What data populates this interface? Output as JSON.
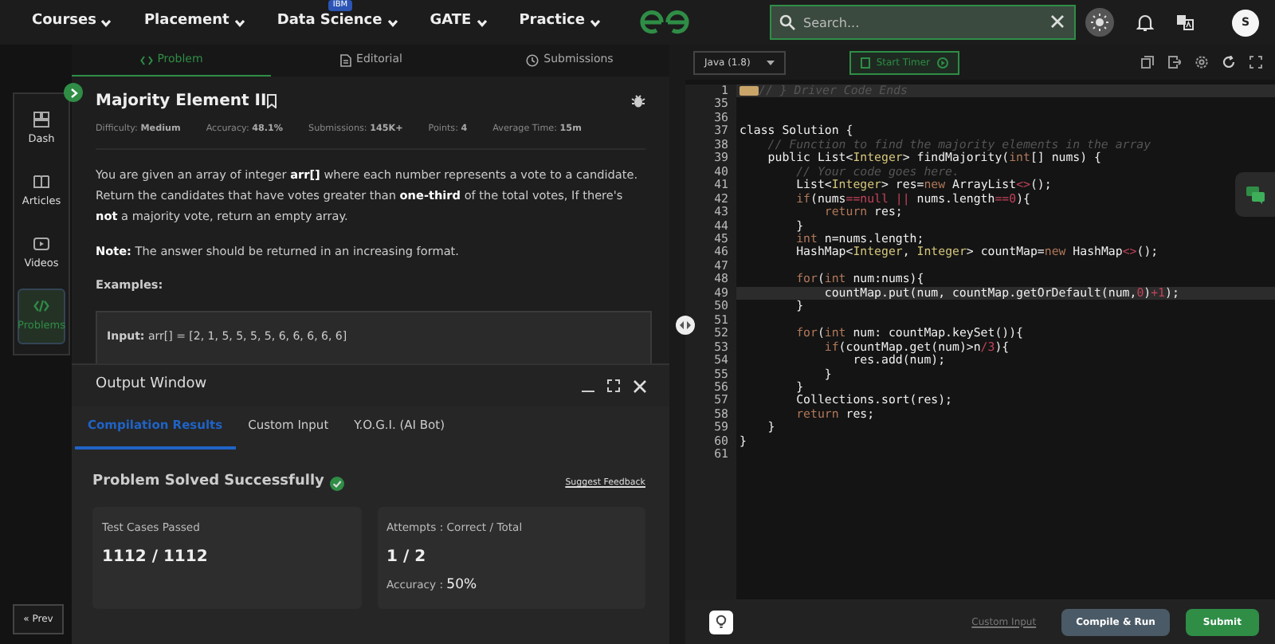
{
  "nav": {
    "items": [
      {
        "label": "Courses"
      },
      {
        "label": "Placement"
      },
      {
        "label": "Data Science",
        "badge": "IBM"
      },
      {
        "label": "GATE"
      },
      {
        "label": "Practice"
      }
    ],
    "search": {
      "placeholder": "Search..."
    },
    "avatar": "S"
  },
  "problem_tabs": [
    {
      "label": "Problem",
      "selected": true
    },
    {
      "label": "Editorial",
      "selected": false
    },
    {
      "label": "Submissions",
      "selected": false
    }
  ],
  "sidebar": {
    "items": [
      {
        "label": "Dash",
        "selected": false
      },
      {
        "label": "Articles",
        "selected": false
      },
      {
        "label": "Videos",
        "selected": false
      },
      {
        "label": "Problems",
        "selected": true
      }
    ],
    "prev_button": "« Prev"
  },
  "problem": {
    "title": "Majority Element II",
    "meta": [
      {
        "label": "Difficulty:",
        "value": "Medium"
      },
      {
        "label": "Accuracy:",
        "value": "48.1%"
      },
      {
        "label": "Submissions:",
        "value": "145K+"
      },
      {
        "label": "Points:",
        "value": "4"
      },
      {
        "label": "Average Time:",
        "value": "15m"
      }
    ],
    "paragraphs": [
      "You are given an array of integer **arr[]** where each number represents a vote to a candidate. Return the candidates that have votes greater than **one-third** of the total votes, If there's **not** a majority vote, return an empty array.",
      "**Note:** The answer should be returned in an increasing format."
    ],
    "examples_heading": "Examples:",
    "example_input": "**Input:** arr[] = [2, 1, 5, 5, 5, 5, 6, 6, 6, 6, 6]"
  },
  "output_window": {
    "title": "Output Window",
    "tabs": [
      {
        "label": "Compilation Results",
        "selected": true
      },
      {
        "label": "Custom Input",
        "selected": false
      },
      {
        "label": "Y.O.G.I. (AI Bot)",
        "selected": false
      }
    ],
    "status": "Problem Solved Successfully",
    "feedback_link": "Suggest Feedback",
    "cards": [
      {
        "label": "Test Cases Passed",
        "value": "1112 / 1112"
      },
      {
        "label": "Attempts : Correct / Total",
        "value": "1 / 2",
        "extra_label": "Accuracy :",
        "extra_value": "50%"
      }
    ]
  },
  "editor": {
    "language": "Java (1.8)",
    "timer_button": "Start Timer",
    "lines": [
      {
        "num": "1",
        "highlighted": true,
        "folded": true,
        "segments": [
          {
            "text": "// } Driver Code Ends",
            "kind": "comment"
          }
        ]
      },
      {
        "num": "35",
        "highlighted": false
      },
      {
        "num": "36",
        "highlighted": false
      },
      {
        "num": "37",
        "highlighted": false,
        "segments": [
          {
            "text": "class Solution {",
            "kind": "plain"
          }
        ]
      },
      {
        "num": "38",
        "highlighted": false,
        "segments": [
          {
            "text": "    // Function to find the majority elements in the array",
            "kind": "comment"
          }
        ]
      },
      {
        "num": "39",
        "highlighted": false,
        "segments": [
          {
            "text": "    public List<",
            "kind": "plain"
          },
          {
            "text": "Integer",
            "kind": "type"
          },
          {
            "text": "> findMajority(",
            "kind": "plain"
          },
          {
            "text": "int",
            "kind": "keyword"
          },
          {
            "text": "[] nums) {",
            "kind": "plain"
          }
        ]
      },
      {
        "num": "40",
        "highlighted": false,
        "segments": [
          {
            "text": "        // Your code goes here.",
            "kind": "comment"
          }
        ]
      },
      {
        "num": "41",
        "highlighted": false,
        "segments": [
          {
            "text": "        List<",
            "kind": "plain"
          },
          {
            "text": "Integer",
            "kind": "type"
          },
          {
            "text": "> res=",
            "kind": "plain"
          },
          {
            "text": "new",
            "kind": "keyword"
          },
          {
            "text": " ArrayList",
            "kind": "plain"
          },
          {
            "text": "<>",
            "kind": "operator"
          },
          {
            "text": "();",
            "kind": "plain"
          }
        ]
      },
      {
        "num": "42",
        "highlighted": false,
        "segments": [
          {
            "text": "        if",
            "kind": "keyword"
          },
          {
            "text": "(nums",
            "kind": "plain"
          },
          {
            "text": "==null || ",
            "kind": "operator"
          },
          {
            "text": "nums.length",
            "kind": "plain"
          },
          {
            "text": "==0",
            "kind": "operator"
          },
          {
            "text": "){",
            "kind": "plain"
          }
        ]
      },
      {
        "num": "43",
        "highlighted": false,
        "segments": [
          {
            "text": "            return",
            "kind": "keyword"
          },
          {
            "text": " res;",
            "kind": "plain"
          }
        ]
      },
      {
        "num": "44",
        "highlighted": false,
        "segments": [
          {
            "text": "        }",
            "kind": "plain"
          }
        ]
      },
      {
        "num": "45",
        "highlighted": false,
        "segments": [
          {
            "text": "        int",
            "kind": "keyword"
          },
          {
            "text": " n=nums.length;",
            "kind": "plain"
          }
        ]
      },
      {
        "num": "46",
        "highlighted": false,
        "segments": [
          {
            "text": "        HashMap<",
            "kind": "plain"
          },
          {
            "text": "Integer",
            "kind": "type"
          },
          {
            "text": ", ",
            "kind": "plain"
          },
          {
            "text": "Integer",
            "kind": "type"
          },
          {
            "text": "> countMap=",
            "kind": "plain"
          },
          {
            "text": "new",
            "kind": "keyword"
          },
          {
            "text": " HashMap",
            "kind": "plain"
          },
          {
            "text": "<>",
            "kind": "operator"
          },
          {
            "text": "();",
            "kind": "plain"
          }
        ]
      },
      {
        "num": "47",
        "highlighted": false
      },
      {
        "num": "48",
        "highlighted": false,
        "segments": [
          {
            "text": "        for",
            "kind": "keyword"
          },
          {
            "text": "(",
            "kind": "plain"
          },
          {
            "text": "int",
            "kind": "keyword"
          },
          {
            "text": " num:nums){",
            "kind": "plain"
          }
        ]
      },
      {
        "num": "49",
        "highlighted": true,
        "segments": [
          {
            "text": "            countMap.put(num, countMap.getOrDefault(num,",
            "kind": "plain"
          },
          {
            "text": "0",
            "kind": "operator"
          },
          {
            "text": ")",
            "kind": "plain"
          },
          {
            "text": "+1",
            "kind": "operator"
          },
          {
            "text": ");",
            "kind": "plain"
          }
        ]
      },
      {
        "num": "50",
        "highlighted": false,
        "segments": [
          {
            "text": "        }",
            "kind": "plain"
          }
        ]
      },
      {
        "num": "51",
        "highlighted": false
      },
      {
        "num": "52",
        "highlighted": false,
        "segments": [
          {
            "text": "        for",
            "kind": "keyword"
          },
          {
            "text": "(",
            "kind": "plain"
          },
          {
            "text": "int",
            "kind": "keyword"
          },
          {
            "text": " num: countMap.keySet()){",
            "kind": "plain"
          }
        ]
      },
      {
        "num": "53",
        "highlighted": false,
        "segments": [
          {
            "text": "            if",
            "kind": "keyword"
          },
          {
            "text": "(countMap.get(num)>n",
            "kind": "plain"
          },
          {
            "text": "/3",
            "kind": "operator"
          },
          {
            "text": "){",
            "kind": "plain"
          }
        ]
      },
      {
        "num": "54",
        "highlighted": false,
        "segments": [
          {
            "text": "                res.add(num);",
            "kind": "plain"
          }
        ]
      },
      {
        "num": "55",
        "highlighted": false,
        "segments": [
          {
            "text": "            }",
            "kind": "plain"
          }
        ]
      },
      {
        "num": "56",
        "highlighted": false,
        "segments": [
          {
            "text": "        }",
            "kind": "plain"
          }
        ]
      },
      {
        "num": "57",
        "highlighted": false,
        "segments": [
          {
            "text": "        Collections.sort(res);",
            "kind": "plain"
          }
        ]
      },
      {
        "num": "58",
        "highlighted": false,
        "segments": [
          {
            "text": "        return",
            "kind": "keyword"
          },
          {
            "text": " res;",
            "kind": "plain"
          }
        ]
      },
      {
        "num": "59",
        "highlighted": false,
        "segments": [
          {
            "text": "    }",
            "kind": "plain"
          }
        ]
      },
      {
        "num": "60",
        "highlighted": false,
        "segments": [
          {
            "text": "}",
            "kind": "plain"
          }
        ]
      },
      {
        "num": "61",
        "highlighted": false
      }
    ],
    "footer": {
      "custom_input": "Custom Input",
      "compile_button": "Compile & Run",
      "submit_button": "Submit"
    }
  }
}
